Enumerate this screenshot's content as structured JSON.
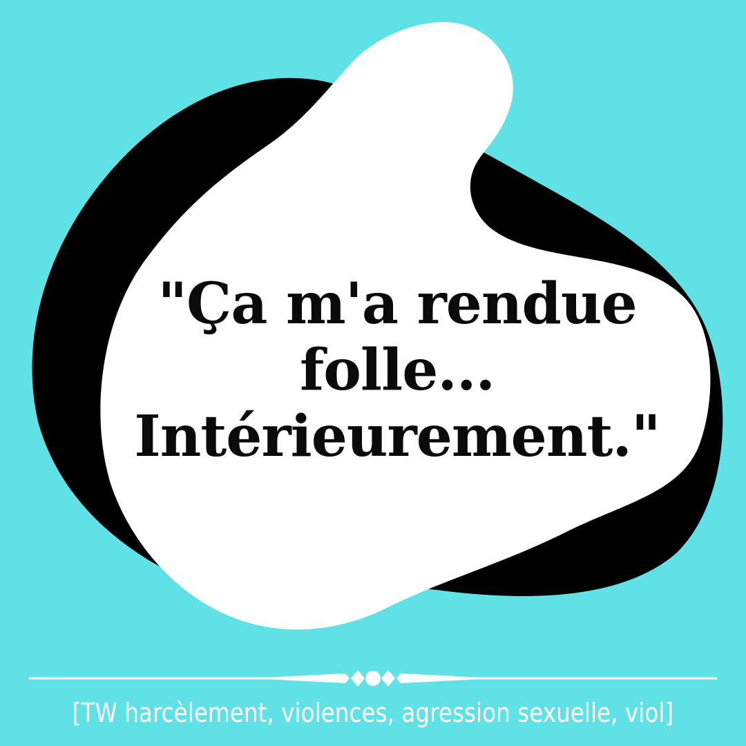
{
  "colors": {
    "background": "#5fe1e5",
    "shadow_blob": "#000000",
    "main_blob": "#ffffff",
    "quote_text": "#0a0a0a",
    "divider": "#ffffff",
    "warning_text": "#ffffff"
  },
  "quote": {
    "line1": "\"Ça m'a  rendue",
    "line2": "folle...",
    "line3": "Intérieurement.\""
  },
  "divider": {
    "style": "ornamental line with center dot"
  },
  "content_warning": {
    "text": "[TW harcèlement, violences, agression sexuelle,  viol]"
  }
}
